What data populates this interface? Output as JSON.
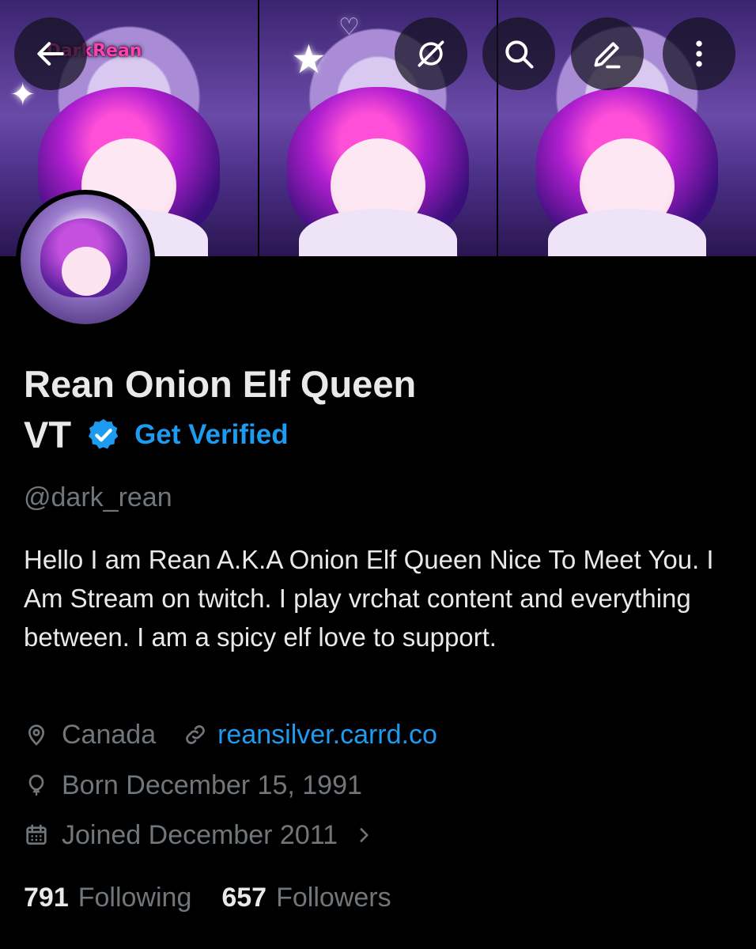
{
  "banner": {
    "logo_text": "DarkRean"
  },
  "header_icons": {
    "back": "arrow-left-icon",
    "no_ads": "no-ads-icon",
    "search": "search-icon",
    "edit": "pencil-icon",
    "more": "more-vertical-icon"
  },
  "profile": {
    "name_line1": "Rean Onion Elf Queen",
    "name_line2": "VT",
    "get_verified_label": "Get Verified",
    "handle": "@dark_rean",
    "bio": "Hello I am Rean A.K.A Onion Elf Queen Nice To Meet You.  I Am Stream on twitch. I play vrchat content and everything between. I am a spicy elf love to support.",
    "location": "Canada",
    "website": "reansilver.carrd.co",
    "birthday": "Born December 15, 1991",
    "joined": "Joined December 2011"
  },
  "stats": {
    "following_count": "791",
    "following_label": "Following",
    "followers_count": "657",
    "followers_label": "Followers"
  },
  "colors": {
    "background": "#000000",
    "text_primary": "#e7e9ea",
    "text_secondary": "#71767b",
    "accent_blue": "#1d9bf0"
  }
}
